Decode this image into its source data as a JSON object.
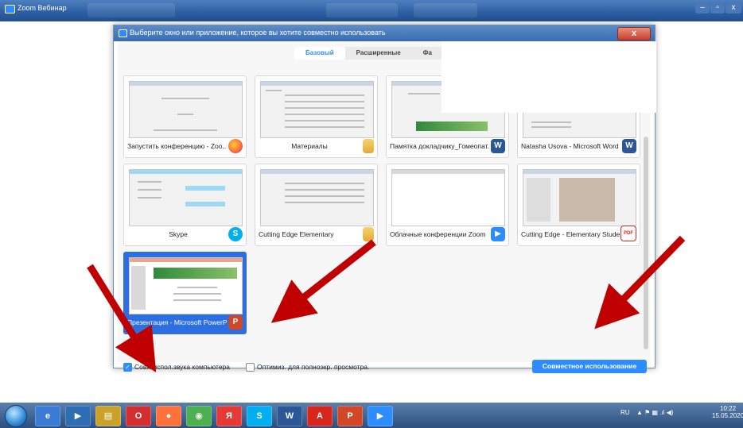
{
  "outer_window": {
    "title": "Zoom Вебинар",
    "minimize": "–",
    "maximize": "▫",
    "close": "x"
  },
  "dialog": {
    "title": "Выберите окно или приложение, которое вы хотите совместно использовать",
    "close": "x",
    "tabs": [
      {
        "label": "Базовый",
        "active": true
      },
      {
        "label": "Расширенные",
        "active": false
      },
      {
        "label": "Фа",
        "active": false
      }
    ],
    "tiles": [
      {
        "label": "Запустить конференцию - Zoo...",
        "icon": "firefox-icon",
        "icon_text": ""
      },
      {
        "label": "Материалы",
        "icon": "folder-icon",
        "icon_text": ""
      },
      {
        "label": "Памятка докладчику_Гомеопат...",
        "icon": "word-icon",
        "icon_text": "W"
      },
      {
        "label": "Natasha Usova - Microsoft Word ...",
        "icon": "word-icon",
        "icon_text": "W"
      },
      {
        "label": "Skype",
        "icon": "skype-icon",
        "icon_text": "S"
      },
      {
        "label": "Cutting Edge Elementary",
        "icon": "folder-icon",
        "icon_text": ""
      },
      {
        "label": "Облачные конференции Zoom",
        "icon": "zoom-icon",
        "icon_text": "▶"
      },
      {
        "label": "Cutting Edge - Elementary Stude...",
        "icon": "pdf-icon",
        "icon_text": "PDF"
      },
      {
        "label": "Презентация - Microsoft PowerP...",
        "icon": "powerpoint-icon",
        "icon_text": "P"
      }
    ],
    "share_audio": {
      "label": "Совм.испол.звука компьютера",
      "checked": true,
      "mark": "✓"
    },
    "optimize": {
      "label": "Оптимиз. для полноэкр. просмотра.",
      "checked": false
    },
    "share_button": "Совместное использование"
  },
  "taskbar": {
    "apps": [
      {
        "name": "ie-icon",
        "text": "e"
      },
      {
        "name": "media-icon",
        "text": "▶"
      },
      {
        "name": "explorer-icon",
        "text": "▤"
      },
      {
        "name": "opera-icon",
        "text": "O"
      },
      {
        "name": "firefox-icon",
        "text": "●"
      },
      {
        "name": "chrome-icon",
        "text": "◉"
      },
      {
        "name": "yandex-icon",
        "text": "Я"
      },
      {
        "name": "skype-icon",
        "text": "S"
      },
      {
        "name": "word-icon",
        "text": "W"
      },
      {
        "name": "acrobat-icon",
        "text": "A"
      },
      {
        "name": "powerpoint-icon",
        "text": "P"
      },
      {
        "name": "zoom-icon",
        "text": "▶"
      }
    ],
    "language": "RU",
    "time": "10:22",
    "date": "15.05.2020"
  },
  "colors": {
    "accent": "#2d8cff",
    "selected_tile": "#2d6fe0",
    "arrow": "#c00000"
  }
}
